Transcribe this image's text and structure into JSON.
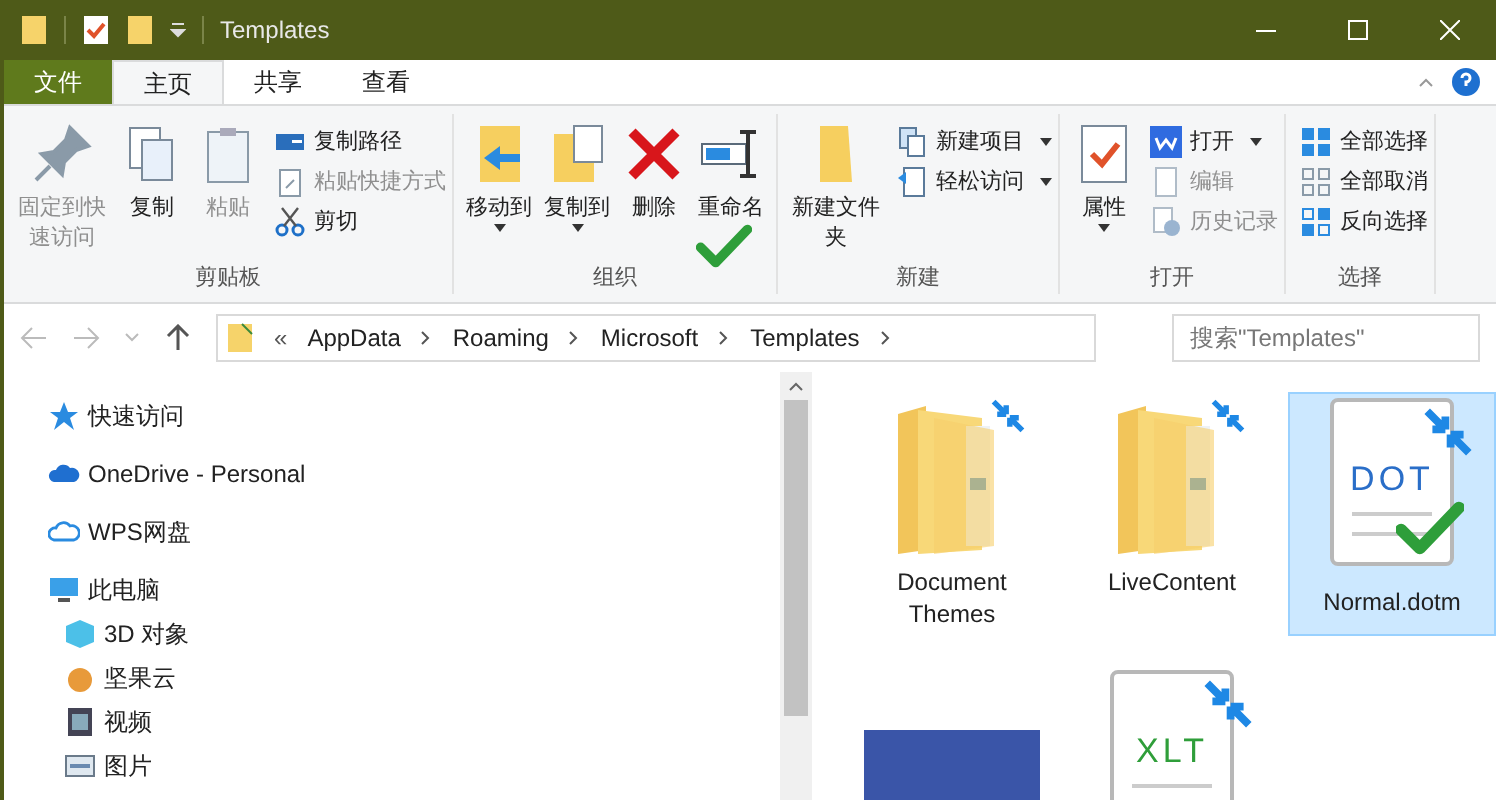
{
  "window": {
    "title": "Templates"
  },
  "tabs": [
    {
      "label": "文件",
      "kind": "file",
      "selected": false
    },
    {
      "label": "主页",
      "kind": "tab",
      "selected": true
    },
    {
      "label": "共享",
      "kind": "tab",
      "selected": false
    },
    {
      "label": "查看",
      "kind": "tab",
      "selected": false
    }
  ],
  "ribbon": {
    "groups": [
      {
        "label": "剪贴板",
        "items": [
          {
            "label": "固定到快速访问",
            "kind": "large",
            "disabled": true,
            "has_menu": false
          },
          {
            "label": "复制",
            "kind": "large",
            "disabled": false,
            "has_menu": false
          },
          {
            "label": "粘贴",
            "kind": "large",
            "disabled": true,
            "has_menu": false
          },
          {
            "label": "复制路径",
            "kind": "small",
            "disabled": false,
            "has_menu": false
          },
          {
            "label": "粘贴快捷方式",
            "kind": "small",
            "disabled": true,
            "has_menu": false
          },
          {
            "label": "剪切",
            "kind": "small",
            "disabled": false,
            "has_menu": false
          }
        ]
      },
      {
        "label": "组织",
        "items": [
          {
            "label": "移动到",
            "kind": "large",
            "disabled": false,
            "has_menu": true
          },
          {
            "label": "复制到",
            "kind": "large",
            "disabled": false,
            "has_menu": true
          },
          {
            "label": "删除",
            "kind": "large",
            "disabled": false,
            "has_menu": false
          },
          {
            "label": "重命名",
            "kind": "large",
            "disabled": false,
            "has_menu": false
          }
        ]
      },
      {
        "label": "新建",
        "items": [
          {
            "label": "新建文件夹",
            "kind": "large",
            "disabled": false,
            "has_menu": false
          },
          {
            "label": "新建项目",
            "kind": "small",
            "disabled": false,
            "has_menu": true
          },
          {
            "label": "轻松访问",
            "kind": "small",
            "disabled": false,
            "has_menu": true
          }
        ]
      },
      {
        "label": "打开",
        "items": [
          {
            "label": "属性",
            "kind": "large",
            "disabled": false,
            "has_menu": true
          },
          {
            "label": "打开",
            "kind": "small",
            "disabled": false,
            "has_menu": true
          },
          {
            "label": "编辑",
            "kind": "small",
            "disabled": true,
            "has_menu": false
          },
          {
            "label": "历史记录",
            "kind": "small",
            "disabled": true,
            "has_menu": false
          }
        ]
      },
      {
        "label": "选择",
        "items": [
          {
            "label": "全部选择",
            "kind": "small",
            "disabled": false,
            "has_menu": false
          },
          {
            "label": "全部取消",
            "kind": "small",
            "disabled": false,
            "has_menu": false
          },
          {
            "label": "反向选择",
            "kind": "small",
            "disabled": false,
            "has_menu": false
          }
        ]
      }
    ]
  },
  "address": {
    "prefix": "«",
    "crumbs": [
      "AppData",
      "Roaming",
      "Microsoft",
      "Templates"
    ]
  },
  "search": {
    "placeholder": "搜索\"Templates\""
  },
  "nav": [
    {
      "label": "快速访问",
      "kind": "star"
    },
    {
      "label": "OneDrive - Personal",
      "kind": "cloud"
    },
    {
      "label": "WPS网盘",
      "kind": "cloud-outline"
    },
    {
      "label": "此电脑",
      "kind": "pc",
      "children": [
        {
          "label": "3D 对象",
          "kind": "cube"
        },
        {
          "label": "坚果云",
          "kind": "nut"
        },
        {
          "label": "视频",
          "kind": "video"
        },
        {
          "label": "图片",
          "kind": "picture"
        }
      ]
    }
  ],
  "files": [
    {
      "name": "Document Themes",
      "kind": "folder",
      "selected": false
    },
    {
      "name": "LiveContent",
      "kind": "folder",
      "selected": false
    },
    {
      "name": "Normal.dotm",
      "kind": "doc",
      "badge": "DOT",
      "selected": true
    },
    {
      "kind": "thumbnail",
      "selected": false
    },
    {
      "kind": "doc",
      "badge": "XLT",
      "selected": false
    }
  ]
}
